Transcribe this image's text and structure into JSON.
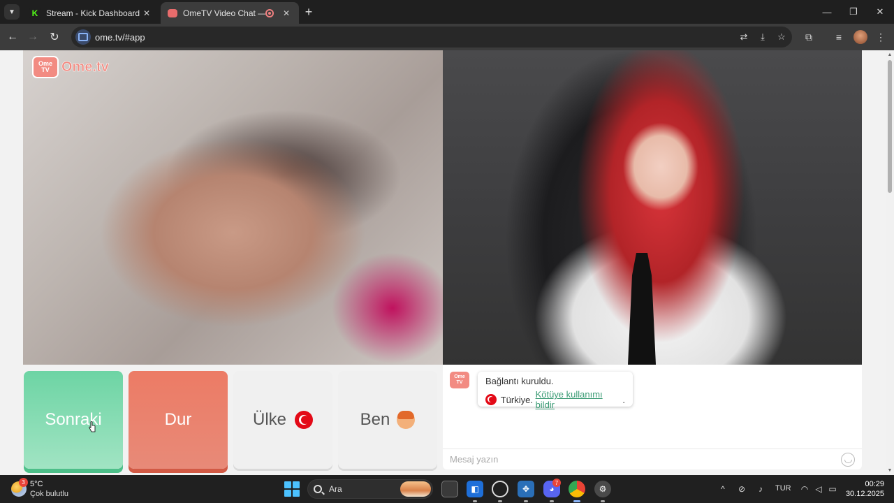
{
  "browser": {
    "tabs": [
      {
        "title": "Stream - Kick Dashboard",
        "favicon": "kick-icon",
        "favicon_text": "K",
        "active": false
      },
      {
        "title": "OmeTV Video Chat — Ome",
        "favicon": "ometv-icon",
        "active": true
      }
    ],
    "url": "ome.tv/#app",
    "new_tab_symbol": "+"
  },
  "page": {
    "logo": {
      "badge_line1": "Ome",
      "badge_line2": "TV",
      "text": "Ome.tv"
    },
    "buttons": {
      "next": "Sonraki",
      "stop": "Dur",
      "country": "Ülke",
      "me": "Ben"
    },
    "chat": {
      "avatar_line1": "Ome",
      "avatar_line2": "TV",
      "connected_message": "Bağlantı kuruldu.",
      "country_name": "Türkiye.",
      "report_link": "Kötüye kullanımı bildir",
      "report_suffix": ".",
      "input_placeholder": "Mesaj yazın"
    },
    "remote_video_label": "",
    "local_video_label": ""
  },
  "taskbar": {
    "weather": {
      "temp": "5°C",
      "desc": "Çok bulutlu",
      "badge": "3"
    },
    "search_placeholder": "Ara",
    "discord_badge": "7",
    "language": "TUR",
    "time": "00:29",
    "date": "30.12.2025"
  },
  "colors": {
    "next_button": "#6dd4a4",
    "stop_button": "#ec7b65",
    "brand": "#f28b82",
    "link": "#3a9b74",
    "turkey_flag": "#e30a17"
  }
}
